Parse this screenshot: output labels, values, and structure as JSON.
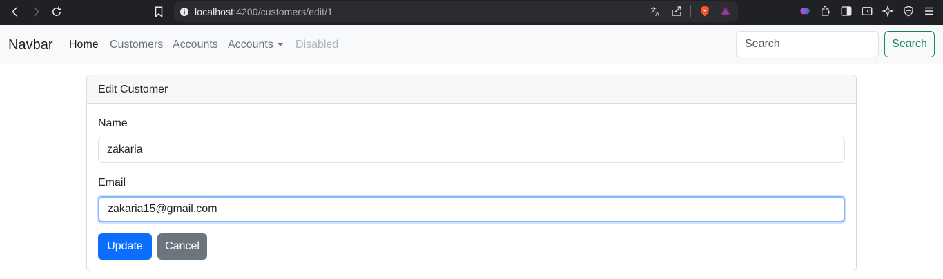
{
  "browser": {
    "url_host": "localhost",
    "url_path": ":4200/customers/edit/1"
  },
  "navbar": {
    "brand": "Navbar",
    "links": [
      {
        "label": "Home"
      },
      {
        "label": "Customers"
      },
      {
        "label": "Accounts"
      },
      {
        "label": "Accounts"
      },
      {
        "label": "Disabled"
      }
    ],
    "search_placeholder": "Search",
    "search_button": "Search"
  },
  "card": {
    "header": "Edit Customer",
    "name_label": "Name",
    "name_value": "zakaria",
    "email_label": "Email",
    "email_value": "zakaria15@gmail.com",
    "update_button": "Update",
    "cancel_button": "Cancel"
  },
  "colors": {
    "primary": "#0d6efd",
    "secondary": "#6c757d",
    "success": "#198754"
  }
}
